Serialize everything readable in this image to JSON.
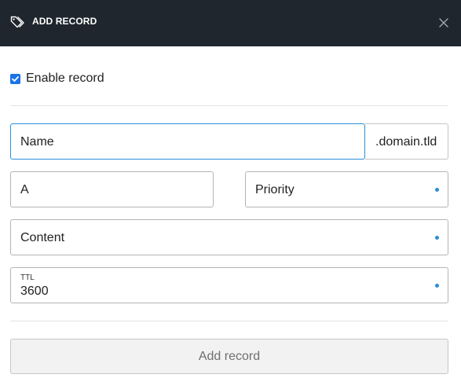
{
  "header": {
    "icon": "tag-icon",
    "title": "ADD RECORD",
    "close_icon": "close-icon"
  },
  "enable": {
    "checked": true,
    "label": "Enable record"
  },
  "fields": {
    "name": {
      "placeholder": "Name",
      "suffix": ".domain.tld",
      "focused": true
    },
    "type": {
      "value": "A"
    },
    "priority": {
      "placeholder": "Priority",
      "required_indicator": true
    },
    "content": {
      "placeholder": "Content",
      "required_indicator": true
    },
    "ttl": {
      "label": "TTL",
      "value": "3600",
      "required_indicator": true
    }
  },
  "submit": {
    "label": "Add record",
    "enabled": false
  },
  "colors": {
    "header_bg": "#1f262d",
    "accent": "#2b8fd6",
    "checkbox": "#1a73e8",
    "button_bg": "#f2f2f2",
    "button_text": "#6f6f6f"
  }
}
